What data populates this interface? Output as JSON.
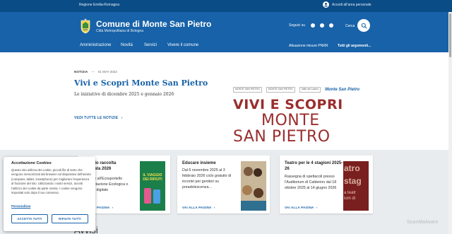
{
  "topbar": {
    "region": "Regione Emilia-Romagna",
    "login": "Accedi all'area personale"
  },
  "header": {
    "title": "Comune di Monte San Pietro",
    "subtitle": "Città Metropolitana di Bologna",
    "social_label": "Seguici su",
    "search_label": "Cerca"
  },
  "nav": {
    "items": [
      "Amministrazione",
      "Novità",
      "Servizi",
      "Vivere il comune"
    ],
    "right_items": [
      "Attuazione misure PNRR",
      "Tutti gli argomenti..."
    ]
  },
  "hero": {
    "category": "NOTIZIA",
    "dash": "—",
    "date": "01 MAY 2023",
    "title": "Vivi e Scopri Monte San Pietro",
    "description": "Le iniziative di dicembre 2025 e gennaio 2026",
    "all_news": "VEDI TUTTE LE NOTIZIE",
    "arrow": "›"
  },
  "hero_image": {
    "logo1": "MONTE SAN PIETRO",
    "logo2": "MONTE SAN PIETRO",
    "logo3": "Valle del Lavino",
    "script": "Monte San Pietro",
    "line1": "VIVI E SCOPRI",
    "line2": "MONTE",
    "line3": "SAN PIETRO"
  },
  "cards": [
    {
      "title_lines": [
        "rio raccolta",
        "iata 2026"
      ],
      "desc_lines": [
        "le all'Ecosportello",
        "Stazione Ecologica o",
        "e digitale"
      ],
      "link": "PAGINA",
      "image_caption": "IL VIAGGIO DEI RIFIUTI"
    },
    {
      "title_lines": [
        "Educare insieme"
      ],
      "desc_lines": [
        "Dal 6 novembre 2025 al 3",
        "febbraio 2026 ciclo gratuito di",
        "incontri per genitori su",
        "preadolescenza..."
      ],
      "link": "VAI ALLA PAGINA"
    },
    {
      "title_lines": [
        "Teatro per le 4 stagioni 2025-",
        "26"
      ],
      "desc_lines": [
        "Rassegna di spettacoli presso",
        "l'Auditorium di Calderino dal 18",
        "ottobre 2025 al 14 giugno 2026"
      ],
      "link": "VAI ALLA PAGINA",
      "image_text": [
        "atro",
        "stag",
        "a teatr",
        "ium di"
      ]
    }
  ],
  "section_title": "Avvisi",
  "cookie": {
    "title": "Accettazione Cookies",
    "text": "Questo sito utilizza dei cookie, piccoli file di testo che vengono memorizzati dal browser sul dispositivo dell'utente (computer, tablet, smartphone) per migliorare l'esperienza di fruizione del sito. Utilizzando i nostri servizi, accetti l'utilizzo dei cookie da parte nostra. I cookie vengono impostati solo dopo il tuo consenso.",
    "link": "Personalizza",
    "accept": "ACCETTA TUTTI",
    "reject": "RIFIUTA TUTTI"
  },
  "watermark": "ScanMalware",
  "colors": {
    "primary": "#1762a8",
    "topbar": "#0a4c86",
    "accent_red": "#9a2d2d",
    "band": "#e8ecef"
  }
}
